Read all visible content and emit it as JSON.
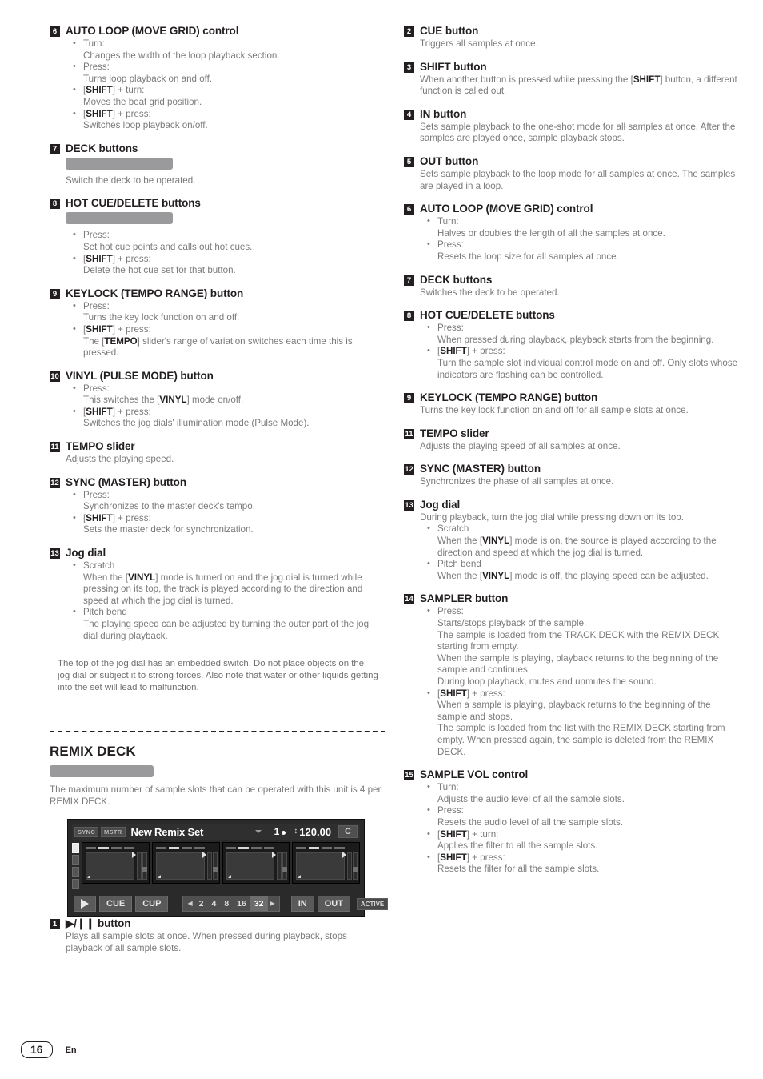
{
  "page": {
    "number": "16",
    "language": "En"
  },
  "left_column": {
    "entries": [
      {
        "num": "6",
        "title": "AUTO LOOP (MOVE GRID) control",
        "bullets": [
          {
            "label": "Turn:",
            "text": "Changes the width of the loop playback section."
          },
          {
            "label": "Press:",
            "text": "Turns loop playback on and off."
          },
          {
            "label": "[SHIFT] + turn:",
            "key": "SHIFT",
            "suffix": "] + turn:",
            "text": "Moves the beat grid position."
          },
          {
            "label": "[SHIFT] + press:",
            "key": "SHIFT",
            "suffix": "] + press:",
            "text": "Switches loop playback on/off."
          }
        ]
      },
      {
        "num": "7",
        "title": "DECK buttons",
        "redacted_bar": true,
        "body": "Switch the deck to be operated."
      },
      {
        "num": "8",
        "title": "HOT CUE/DELETE buttons",
        "redacted_bar": true,
        "bullets": [
          {
            "label": "Press:",
            "text": "Set hot cue points and calls out hot cues."
          },
          {
            "label": "[SHIFT] + press:",
            "key": "SHIFT",
            "suffix": "] + press:",
            "text": "Delete the hot cue set for that button."
          }
        ]
      },
      {
        "num": "9",
        "title": "KEYLOCK (TEMPO RANGE) button",
        "bullets": [
          {
            "label": "Press:",
            "text": "Turns the key lock function on and off."
          },
          {
            "label": "[SHIFT] + press:",
            "key": "SHIFT",
            "suffix": "] + press:",
            "text": "The [TEMPO] slider's range of variation switches each time this is pressed.",
            "inline_key": "TEMPO"
          }
        ]
      },
      {
        "num": "10",
        "title": "VINYL (PULSE MODE) button",
        "bullets": [
          {
            "label": "Press:",
            "text": "This switches the [VINYL] mode on/off.",
            "inline_key": "VINYL"
          },
          {
            "label": "[SHIFT] + press:",
            "key": "SHIFT",
            "suffix": "] + press:",
            "text": "Switches the jog dials' illumination mode (Pulse Mode)."
          }
        ]
      },
      {
        "num": "11",
        "title": "TEMPO slider",
        "body": "Adjusts the playing speed."
      },
      {
        "num": "12",
        "title": "SYNC (MASTER) button",
        "bullets": [
          {
            "label": "Press:",
            "text": "Synchronizes to the master deck's tempo."
          },
          {
            "label": "[SHIFT] + press:",
            "key": "SHIFT",
            "suffix": "] + press:",
            "text": "Sets the master deck for synchronization."
          }
        ]
      },
      {
        "num": "13",
        "title": "Jog dial",
        "bullets": [
          {
            "label": "Scratch",
            "text": "When the [VINYL] mode is turned on and the jog dial is turned while pressing on its top, the track is played according to the direction and speed at which the jog dial is turned.",
            "inline_key": "VINYL"
          },
          {
            "label": "Pitch bend",
            "text": "The playing speed can be adjusted by turning the outer part of the jog dial during playback."
          }
        ]
      }
    ],
    "caution": "The top of the jog dial has an embedded switch. Do not place objects on the jog dial or subject it to strong forces. Also note that water or other liquids getting into the set will lead to malfunction.",
    "section": {
      "title": "REMIX DECK",
      "redacted_bar": true,
      "body": "The maximum number of sample slots that can be operated with this unit is 4 per REMIX DECK."
    },
    "device_screenshot": {
      "sync_label": "SYNC",
      "mstr_label": "MSTR",
      "set_name": "New Remix Set",
      "beat_value": "1",
      "bpm_value": "120.00",
      "key_label": "C",
      "play_icon": "play-triangle-icon",
      "cue_label": "CUE",
      "cup_label": "CUP",
      "loop_values": [
        "2",
        "4",
        "8",
        "16",
        "32"
      ],
      "loop_selected": "32",
      "in_label": "IN",
      "out_label": "OUT",
      "active_label": "ACTIVE",
      "slot_count": 4
    },
    "final_entry": {
      "num": "1",
      "title": "▶/❙❙ button",
      "body": "Plays all sample slots at once. When pressed during playback, stops playback of all sample slots."
    }
  },
  "right_column": {
    "entries": [
      {
        "num": "2",
        "title": "CUE button",
        "body": "Triggers all samples at once."
      },
      {
        "num": "3",
        "title": "SHIFT button",
        "body": "When another button is pressed while pressing the [SHIFT] button, a different function is called out.",
        "inline_key": "SHIFT"
      },
      {
        "num": "4",
        "title": "IN button",
        "body": "Sets sample playback to the one-shot mode for all samples at once. After the samples are played once, sample playback stops."
      },
      {
        "num": "5",
        "title": "OUT button",
        "body": "Sets sample playback to the loop mode for all samples at once. The samples are played in a loop."
      },
      {
        "num": "6",
        "title": "AUTO LOOP (MOVE GRID) control",
        "bullets": [
          {
            "label": "Turn:",
            "text": "Halves or doubles the length of all the samples at once."
          },
          {
            "label": "Press:",
            "text": "Resets the loop size for all samples at once."
          }
        ]
      },
      {
        "num": "7",
        "title": "DECK buttons",
        "body": "Switches the deck to be operated."
      },
      {
        "num": "8",
        "title": "HOT CUE/DELETE buttons",
        "bullets": [
          {
            "label": "Press:",
            "text": "When pressed during playback, playback starts from the beginning."
          },
          {
            "label": "[SHIFT] + press:",
            "key": "SHIFT",
            "suffix": "] + press:",
            "text": "Turn the sample slot individual control mode on and off. Only slots whose indicators are flashing can be controlled."
          }
        ]
      },
      {
        "num": "9",
        "title": "KEYLOCK (TEMPO RANGE) button",
        "body": "Turns the key lock function on and off for all sample slots at once."
      },
      {
        "num": "11",
        "title": "TEMPO slider",
        "body": "Adjusts the playing speed of all samples at once."
      },
      {
        "num": "12",
        "title": "SYNC (MASTER) button",
        "body": "Synchronizes the phase of all samples at once."
      },
      {
        "num": "13",
        "title": "Jog dial",
        "body": "During playback, turn the jog dial while pressing down on its top.",
        "bullets": [
          {
            "label": "Scratch",
            "text": "When the [VINYL] mode is on, the source is played according to the direction and speed at which the jog dial is turned.",
            "inline_key": "VINYL"
          },
          {
            "label": "Pitch bend",
            "text": "When the [VINYL] mode is off, the playing speed can be adjusted.",
            "inline_key": "VINYL"
          }
        ]
      },
      {
        "num": "14",
        "title": "SAMPLER button",
        "bullets": [
          {
            "label": "Press:",
            "text": "Starts/stops playback of the sample.\nThe sample is loaded from the TRACK DECK with the REMIX DECK starting from empty.\nWhen the sample is playing, playback returns to the beginning of the sample and continues.\nDuring loop playback, mutes and unmutes the sound."
          },
          {
            "label": "[SHIFT] + press:",
            "key": "SHIFT",
            "suffix": "] + press:",
            "text": "When a sample is playing, playback returns to the beginning of the sample and stops.\nThe sample is loaded from the list with the REMIX DECK starting from empty. When pressed again, the sample is deleted from the REMIX DECK."
          }
        ]
      },
      {
        "num": "15",
        "title": "SAMPLE VOL control",
        "bullets": [
          {
            "label": "Turn:",
            "text": "Adjusts the audio level of all the sample slots."
          },
          {
            "label": "Press:",
            "text": "Resets the audio level of all the sample slots."
          },
          {
            "label": "[SHIFT] + turn:",
            "key": "SHIFT",
            "suffix": "] + turn:",
            "text": "Applies the filter to all the sample slots."
          },
          {
            "label": "[SHIFT] + press:",
            "key": "SHIFT",
            "suffix": "] + press:",
            "text": "Resets the filter for all the sample slots."
          }
        ]
      }
    ]
  }
}
